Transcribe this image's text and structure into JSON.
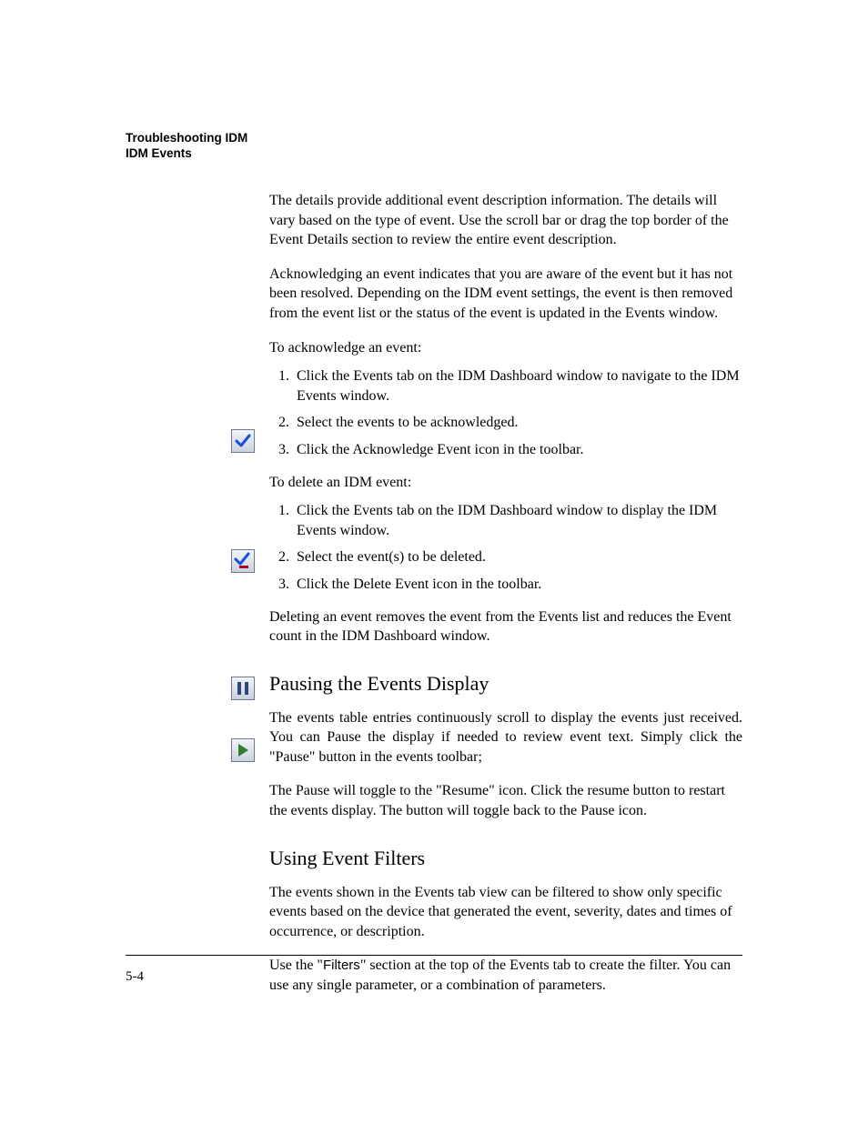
{
  "header": {
    "line1": "Troubleshooting IDM",
    "line2": "IDM Events"
  },
  "paragraphs": {
    "intro1": "The details provide additional event description information. The details will vary based on the type of event. Use the scroll bar or drag the top border of the Event Details section to review the entire event description.",
    "intro2": "Acknowledging an event indicates that you are aware of the event but it has not been resolved. Depending on the IDM event settings, the event is then removed from the event list or the status of the event is updated in the Events window.",
    "ack_lead": "To acknowledge an event:",
    "ack_steps": [
      "Click the Events tab on the IDM Dashboard window to navigate to the IDM Events window.",
      "Select the events to be acknowledged.",
      "Click the Acknowledge Event icon in the toolbar."
    ],
    "del_lead": "To delete an IDM event:",
    "del_steps": [
      "Click the Events tab on the IDM Dashboard window to display the IDM Events window.",
      "Select the event(s) to be deleted.",
      "Click the Delete Event icon in the toolbar."
    ],
    "del_after": "Deleting an event removes the event from the Events list and reduces the Event count in the IDM Dashboard window.",
    "pause_heading": "Pausing the Events Display",
    "pause_p1": "The events table entries continuously scroll to display the events just received. You can Pause the display if needed to review event text. Simply click the \"Pause\" button in the events toolbar;",
    "pause_p2": "The Pause will toggle to the \"Resume\" icon. Click the resume button to restart the events display. The button will toggle back to the Pause icon.",
    "filters_heading": "Using Event Filters",
    "filters_p1": "The events shown in the Events tab view can be filtered to show only specific events based on the device that generated the event, severity, dates and times of occurrence, or description.",
    "filters_p2_pre": "Use the \"",
    "filters_word": "Filters",
    "filters_p2_post": "\" section at the top of the Events tab to create the filter. You can use any single parameter, or a combination of parameters."
  },
  "footer": {
    "page": "5-4"
  }
}
